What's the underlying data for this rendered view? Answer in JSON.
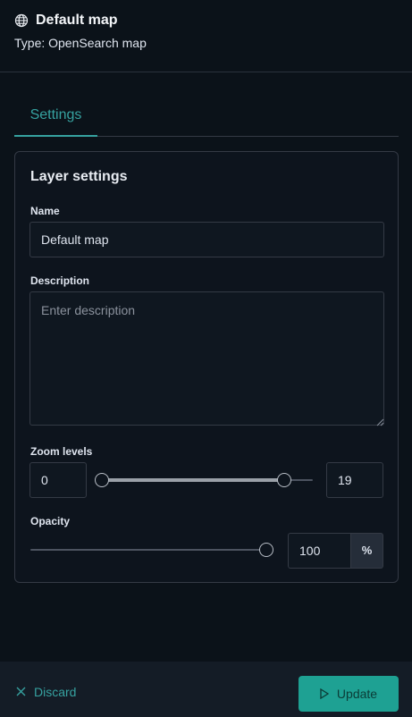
{
  "header": {
    "icon": "globe-icon",
    "title": "Default map",
    "subtitle": "Type: OpenSearch map"
  },
  "tabs": [
    {
      "label": "Settings",
      "active": true
    }
  ],
  "layer_settings": {
    "title": "Layer settings",
    "name": {
      "label": "Name",
      "value": "Default map"
    },
    "description": {
      "label": "Description",
      "value": "",
      "placeholder": "Enter description"
    },
    "zoom": {
      "label": "Zoom levels",
      "min_value": "0",
      "max_value": "19",
      "range_min": 0,
      "range_max": 22
    },
    "opacity": {
      "label": "Opacity",
      "value": "100",
      "unit": "%"
    }
  },
  "footer": {
    "discard_label": "Discard",
    "discard_icon": "close-icon",
    "update_label": "Update",
    "update_icon": "play-icon"
  },
  "colors": {
    "background": "#0b1219",
    "accent": "#36a2a0",
    "primary_button": "#1ea193"
  }
}
